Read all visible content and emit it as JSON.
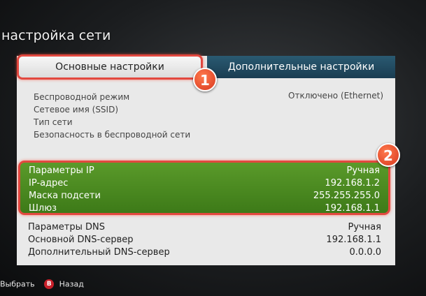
{
  "window": {
    "title": "настройка сети"
  },
  "tabs": {
    "basic": "Основные настройки",
    "advanced": "Дополнительные настройки"
  },
  "wireless": {
    "mode_label": "Беспроводной режим",
    "mode_value": "Отключено (Ethernet)",
    "ssid_label": "Сетевое имя (SSID)",
    "type_label": "Тип сети",
    "security_label": "Безопасность в беспроводной сети"
  },
  "ip": {
    "params_label": "Параметры IP",
    "params_value": "Ручная",
    "address_label": "IP-адрес",
    "address_value": "192.168.1.2",
    "mask_label": "Маска подсети",
    "mask_value": "255.255.255.0",
    "gateway_label": "Шлюз",
    "gateway_value": "192.168.1.1"
  },
  "dns": {
    "params_label": "Параметры DNS",
    "params_value": "Ручная",
    "primary_label": "Основной DNS-сервер",
    "primary_value": "192.168.1.1",
    "secondary_label": "Дополнительный DNS-сервер",
    "secondary_value": "0.0.0.0"
  },
  "markers": {
    "one": "1",
    "two": "2"
  },
  "footer": {
    "select_label": "Выбрать",
    "b_button": "B",
    "back_label": "Назад"
  },
  "colors": {
    "accent_red": "#e2483f",
    "highlight_green": "#4a8a22",
    "tab_blue": "#1f4a60"
  }
}
